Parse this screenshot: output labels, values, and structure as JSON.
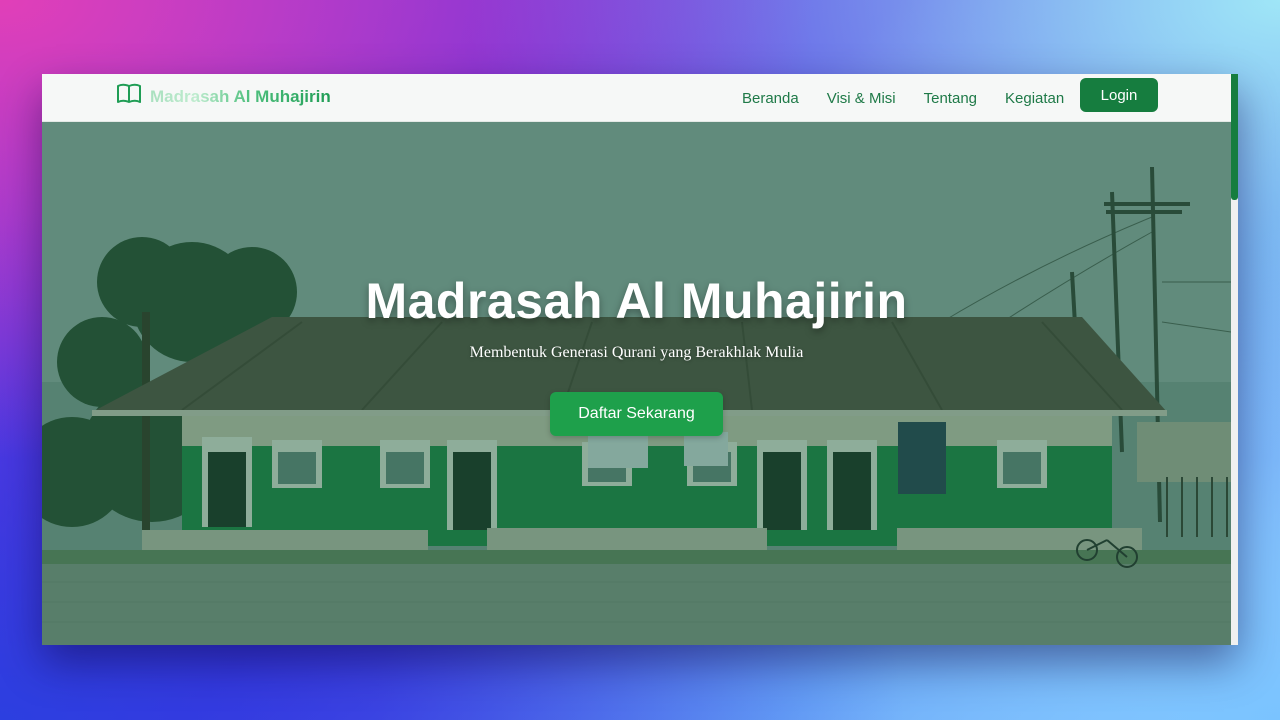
{
  "navbar": {
    "brand": "Madrasah Al Muhajirin",
    "brand_icon": "open-book-icon",
    "links": [
      "Beranda",
      "Visi & Misi",
      "Tentang",
      "Kegiatan"
    ],
    "login": "Login"
  },
  "hero": {
    "title": "Madrasah Al Muhajirin",
    "subtitle": "Membentuk Generasi Qurani yang Berakhlak Mulia",
    "cta": "Daftar Sekarang"
  },
  "colors": {
    "primary": "#167d3f",
    "cta": "#1ea04b",
    "overlay": "#165c3a"
  }
}
